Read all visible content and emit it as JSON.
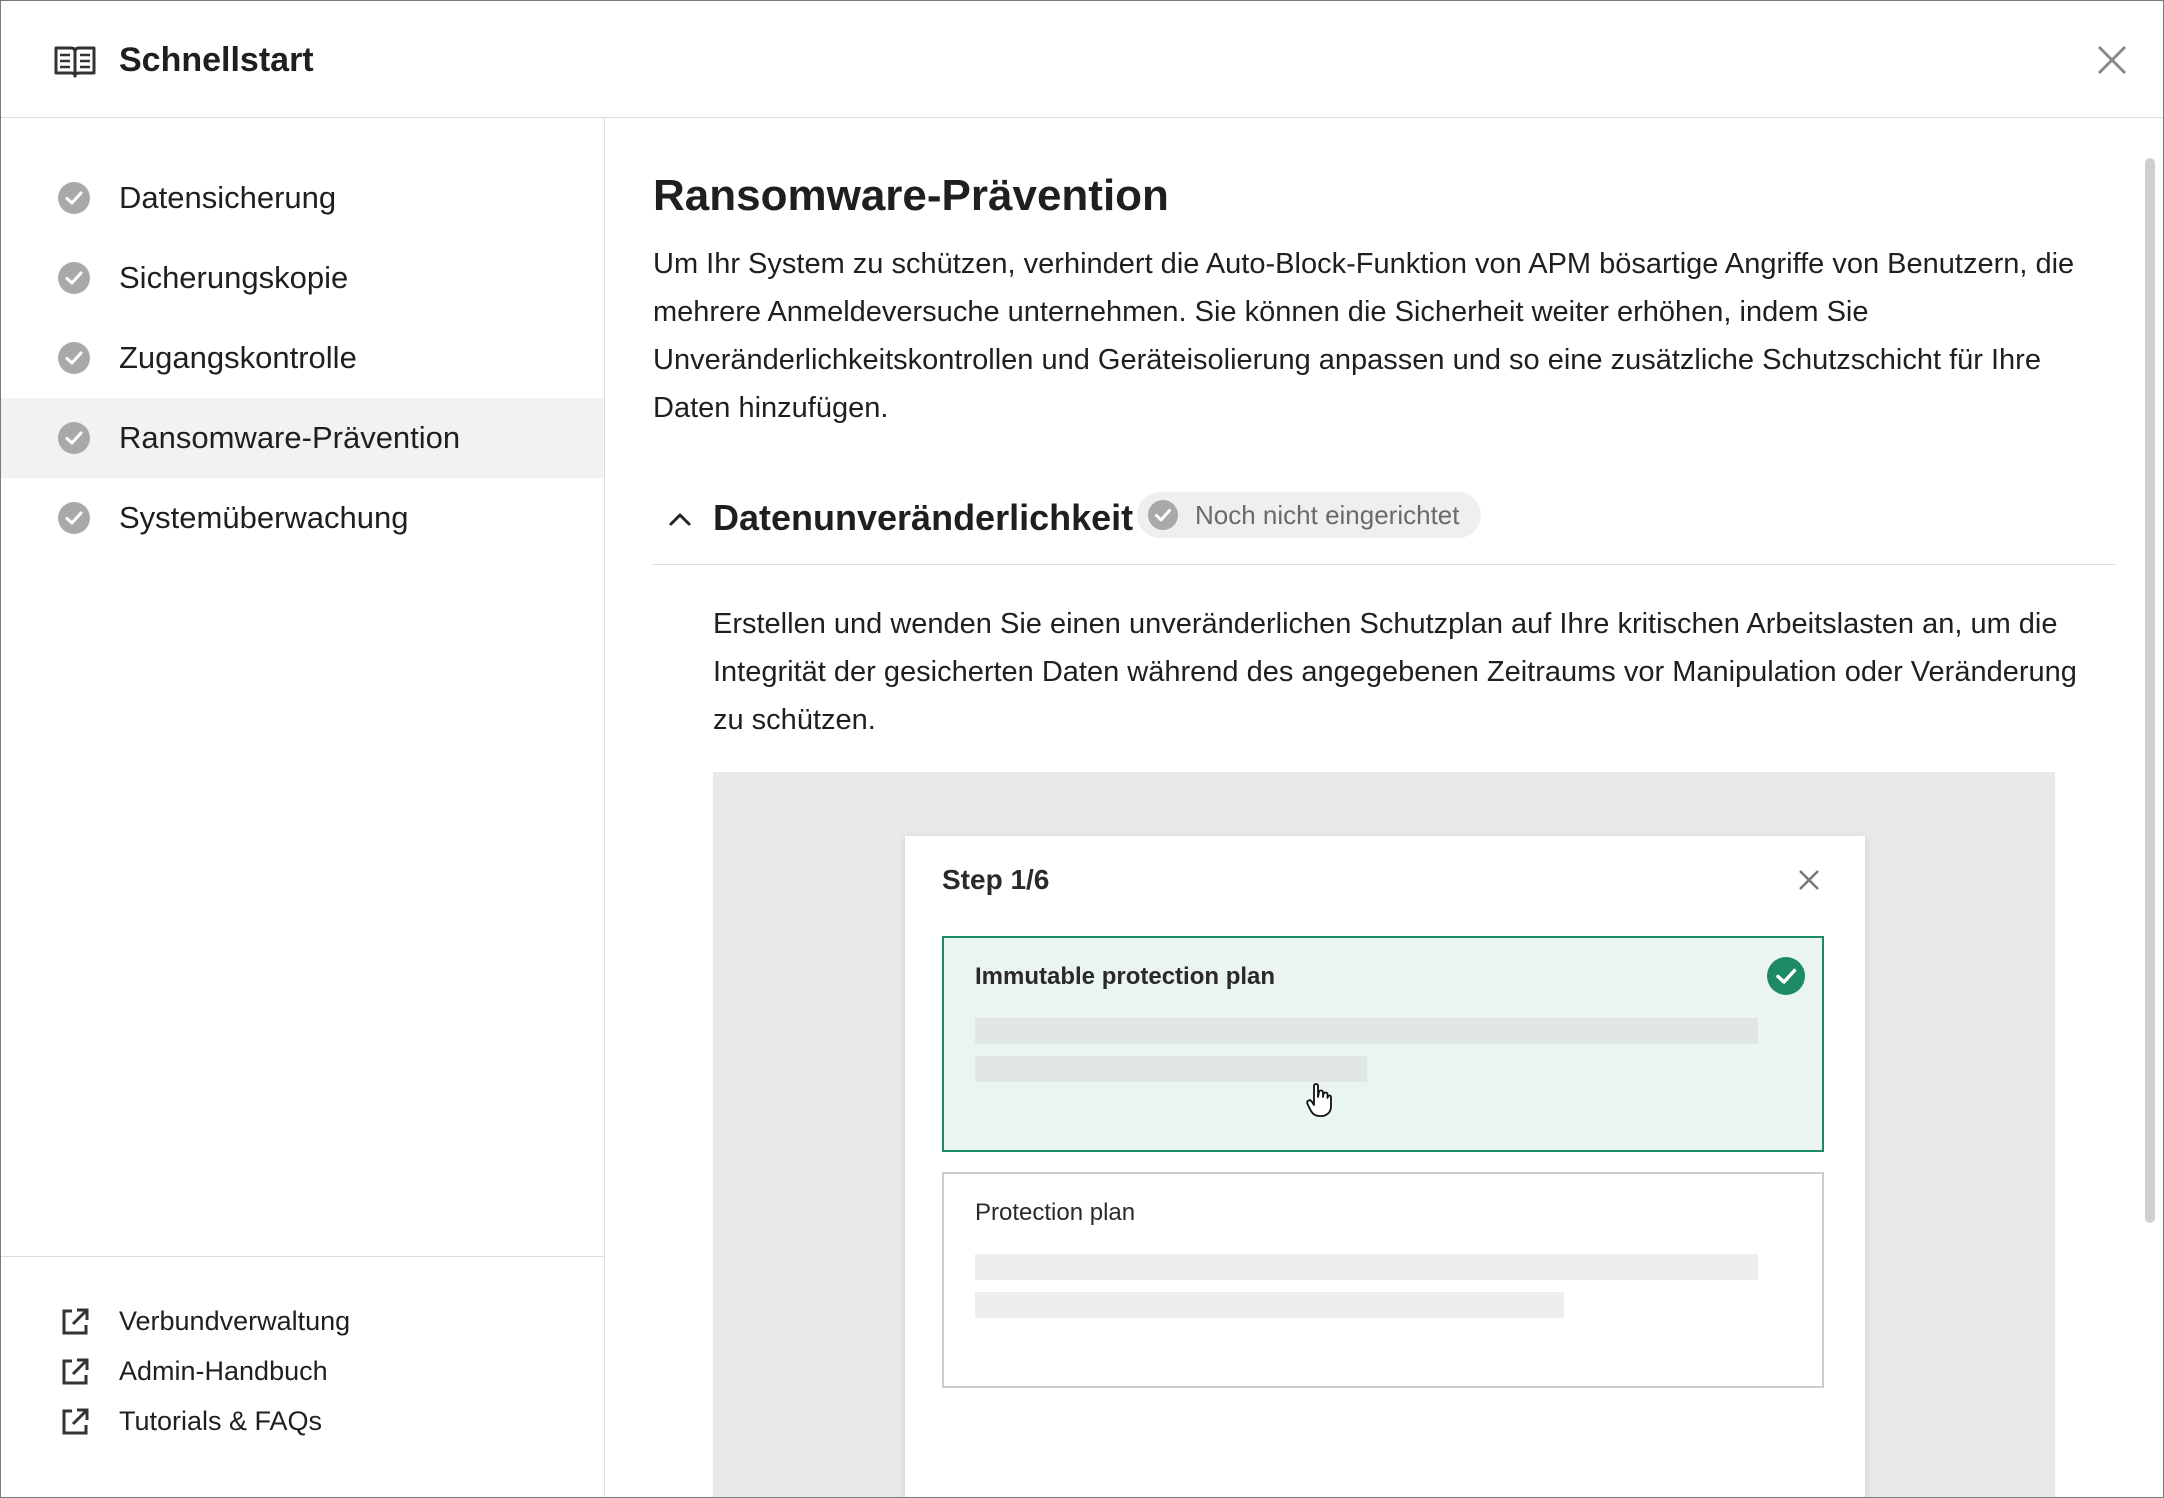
{
  "header": {
    "title": "Schnellstart"
  },
  "sidebar": {
    "items": [
      {
        "label": "Datensicherung"
      },
      {
        "label": "Sicherungskopie"
      },
      {
        "label": "Zugangskontrolle"
      },
      {
        "label": "Ransomware-Prävention"
      },
      {
        "label": "Systemüberwachung"
      }
    ],
    "active_index": 3,
    "links": [
      {
        "label": "Verbundverwaltung"
      },
      {
        "label": "Admin-Handbuch"
      },
      {
        "label": "Tutorials & FAQs"
      }
    ]
  },
  "main": {
    "title": "Ransomware-Prävention",
    "description": "Um Ihr System zu schützen, verhindert die Auto-Block-Funktion von APM bösartige Angriffe von Benutzern, die mehrere Anmeldeversuche unternehmen. Sie können die Sicherheit weiter erhöhen, indem Sie Unveränderlichkeitskontrollen und Geräteisolierung anpassen und so eine zusätzliche Schutzschicht für Ihre Daten hinzufügen.",
    "section": {
      "title": "Datenunveränderlichkeit",
      "status": "Noch nicht eingerichtet",
      "expanded": true,
      "description": "Erstellen und wenden Sie einen unveränderlichen Schutzplan auf Ihre kritischen Arbeitslasten an, um die Integrität der gesicherten Daten während des angegebenen Zeitraums vor Manipulation oder Veränderung zu schützen."
    },
    "illustration": {
      "step": "Step 1/6",
      "options": [
        {
          "label": "Immutable protection plan",
          "selected": true
        },
        {
          "label": "Protection plan",
          "selected": false
        }
      ]
    }
  },
  "colors": {
    "accent": "#1d8a66",
    "selected_bg": "#eaf4f1",
    "check_gray": "#a9a9a9"
  },
  "icons": [
    "book-icon",
    "close-icon",
    "check-circle-icon",
    "external-link-icon",
    "chevron-up-icon",
    "hand-pointer-icon"
  ]
}
